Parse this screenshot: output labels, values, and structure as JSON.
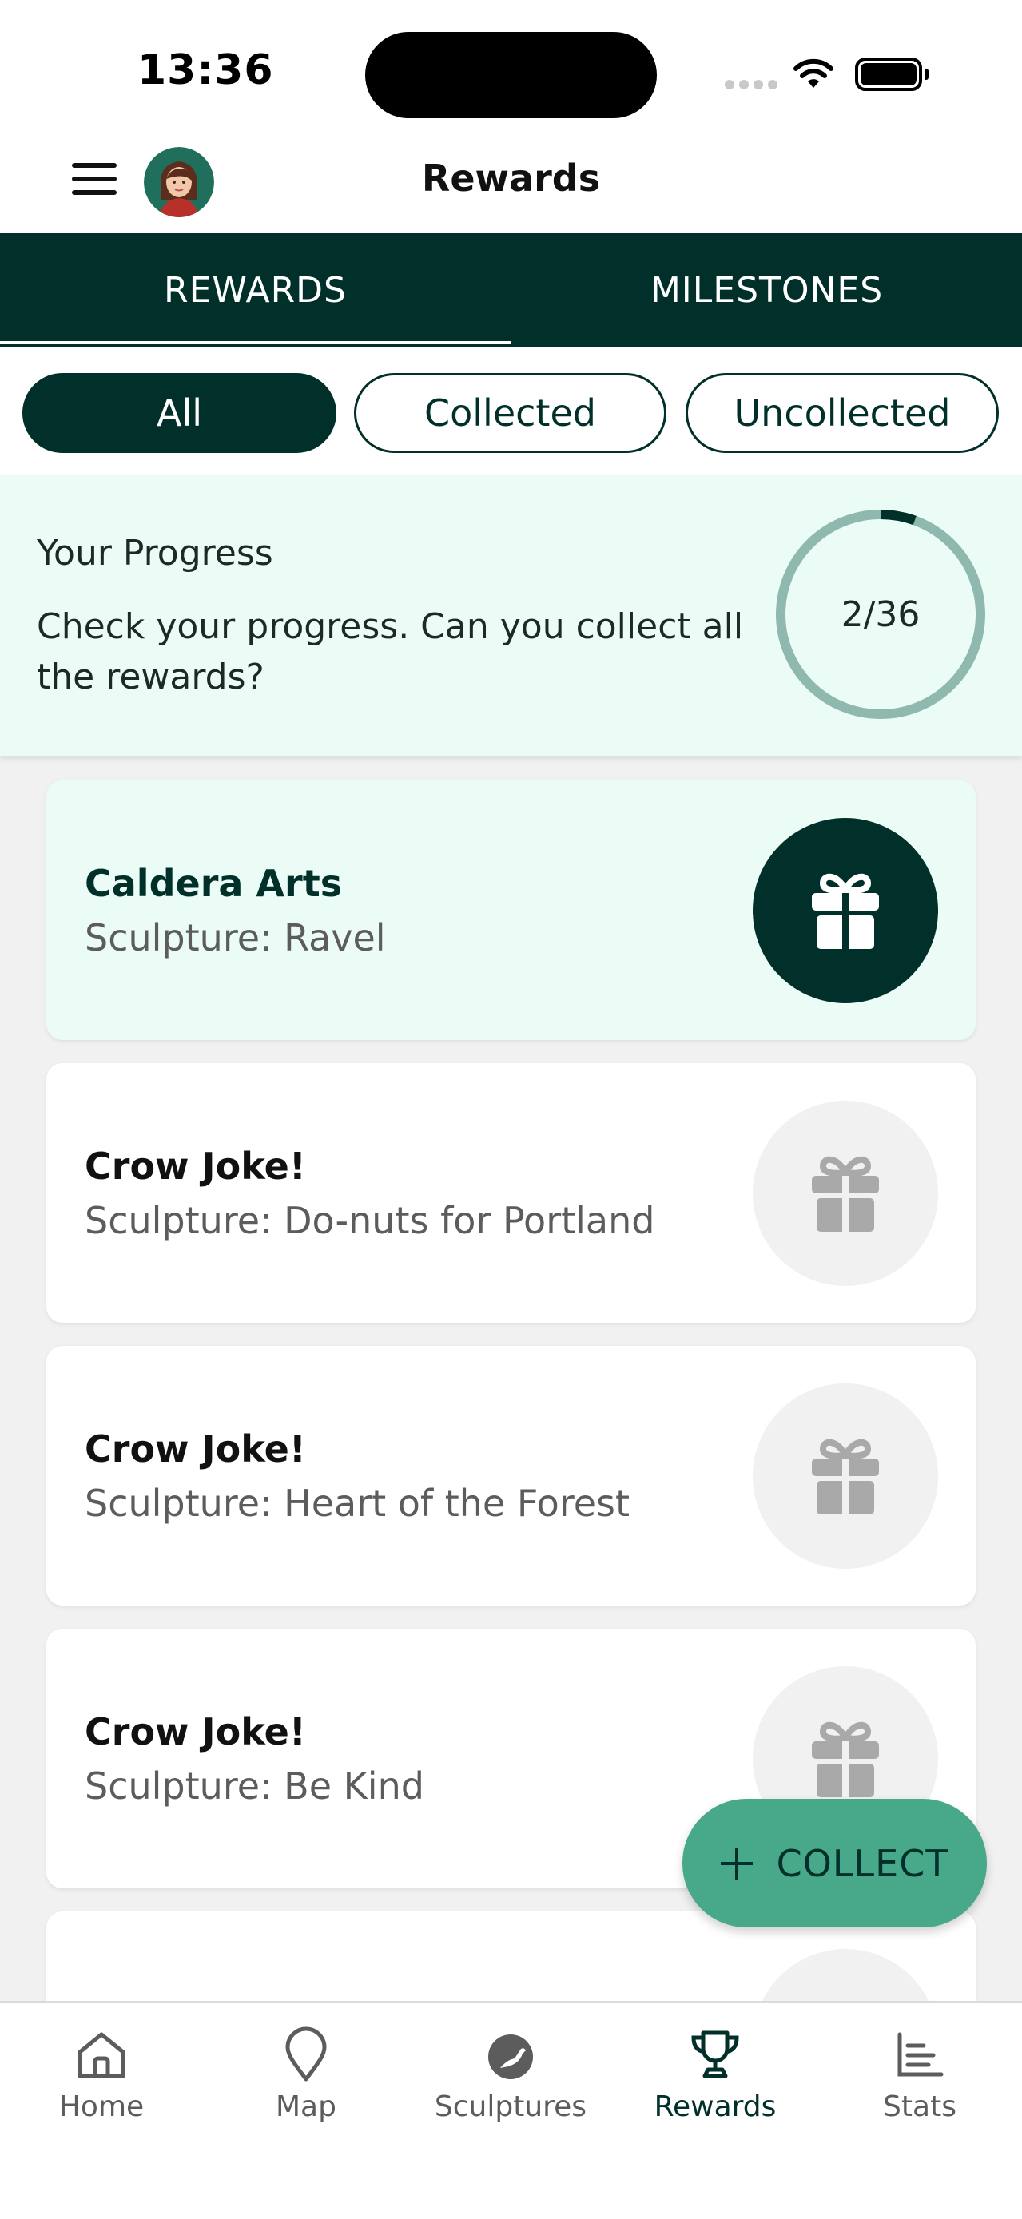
{
  "status_bar": {
    "time": "13:36"
  },
  "header": {
    "title": "Rewards"
  },
  "tabs": [
    {
      "label": "REWARDS",
      "selected": false
    },
    {
      "label": "MILESTONES",
      "selected": true
    }
  ],
  "filters": {
    "all": "All",
    "collected": "Collected",
    "uncollected": "Uncollected",
    "selected": "All"
  },
  "progress": {
    "title": "Your Progress",
    "description": "Check your progress. Can you collect all the rewards?",
    "label": "2/36",
    "collected": 2,
    "total": 36
  },
  "rewards": [
    {
      "title": "Caldera Arts",
      "subtitle": "Sculpture: Ravel",
      "collected": true
    },
    {
      "title": "Crow Joke!",
      "subtitle": "Sculpture: Do-nuts for Portland",
      "collected": false
    },
    {
      "title": "Crow Joke!",
      "subtitle": "Sculpture: Heart of the Forest",
      "collected": false
    },
    {
      "title": "Crow Joke!",
      "subtitle": "Sculpture: Be Kind",
      "collected": false
    }
  ],
  "fab": {
    "label": "COLLECT",
    "icon": "plus-icon"
  },
  "bottom_nav": [
    {
      "label": "Home",
      "icon": "home-icon",
      "active": false
    },
    {
      "label": "Map",
      "icon": "map-pin-icon",
      "active": false
    },
    {
      "label": "Sculptures",
      "icon": "bird-icon",
      "active": false
    },
    {
      "label": "Rewards",
      "icon": "trophy-icon",
      "active": true
    },
    {
      "label": "Stats",
      "icon": "bar-chart-icon",
      "active": false
    }
  ],
  "colors": {
    "primary": "#01302a",
    "accent": "#47a88a",
    "ring_track": "#8fb8ae",
    "tint": "#ebfcf6",
    "inactive_badge": "#f1f1f1",
    "inactive_icon": "#a9a9a9"
  }
}
